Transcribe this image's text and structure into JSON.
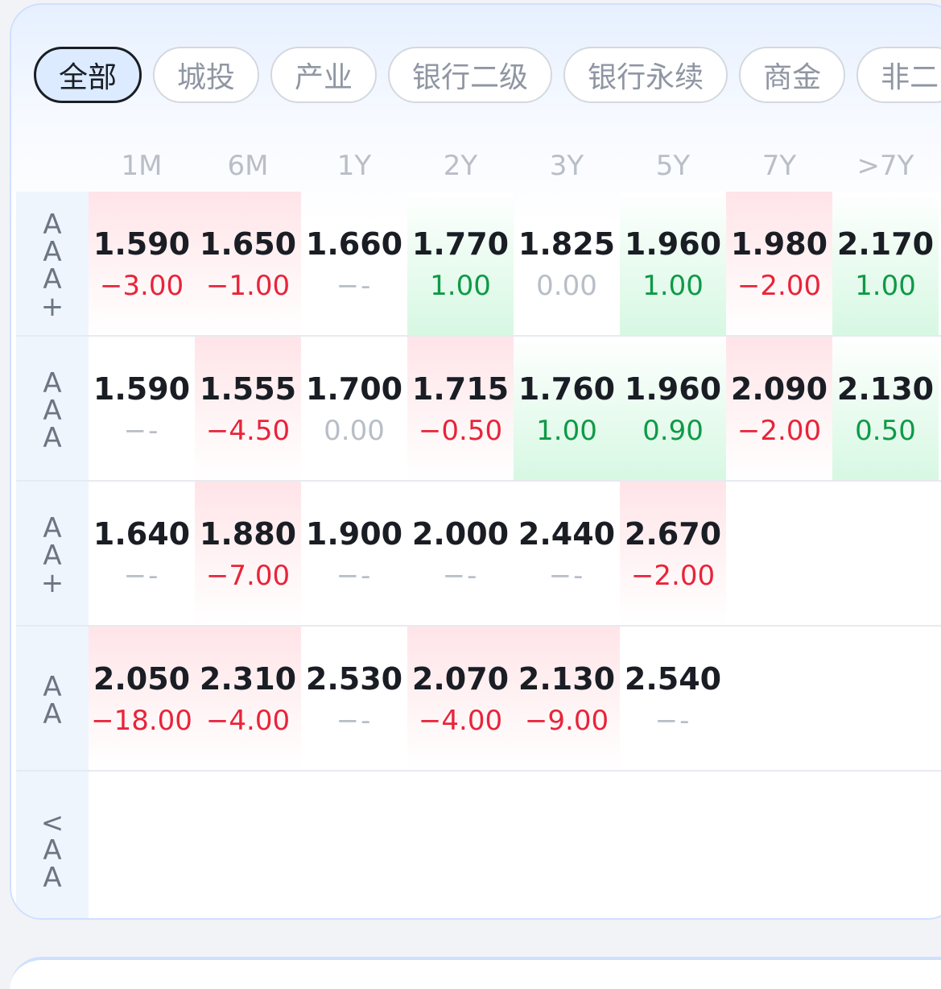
{
  "tabs": [
    {
      "label": "全部",
      "active": true
    },
    {
      "label": "城投",
      "active": false
    },
    {
      "label": "产业",
      "active": false
    },
    {
      "label": "银行二级",
      "active": false
    },
    {
      "label": "银行永续",
      "active": false
    },
    {
      "label": "商金",
      "active": false
    },
    {
      "label": "非二",
      "active": false
    }
  ],
  "tenors": [
    "1M",
    "6M",
    "1Y",
    "2Y",
    "3Y",
    "5Y",
    "7Y",
    ">7Y"
  ],
  "colors": {
    "up_red": "#e8243a",
    "down_green": "#0e9a47",
    "muted": "#b8bec7"
  },
  "rows": [
    {
      "rating": "AAA+",
      "cells": [
        {
          "yield": "1.590",
          "change": "-3.00",
          "dir": "up"
        },
        {
          "yield": "1.650",
          "change": "-1.00",
          "dir": "up"
        },
        {
          "yield": "1.660",
          "change": "--",
          "dir": "none"
        },
        {
          "yield": "1.770",
          "change": "1.00",
          "dir": "down"
        },
        {
          "yield": "1.825",
          "change": "0.00",
          "dir": "zero"
        },
        {
          "yield": "1.960",
          "change": "1.00",
          "dir": "down"
        },
        {
          "yield": "1.980",
          "change": "-2.00",
          "dir": "up"
        },
        {
          "yield": "2.170",
          "change": "1.00",
          "dir": "down"
        }
      ]
    },
    {
      "rating": "AAA",
      "cells": [
        {
          "yield": "1.590",
          "change": "--",
          "dir": "none"
        },
        {
          "yield": "1.555",
          "change": "-4.50",
          "dir": "up"
        },
        {
          "yield": "1.700",
          "change": "0.00",
          "dir": "zero"
        },
        {
          "yield": "1.715",
          "change": "-0.50",
          "dir": "up"
        },
        {
          "yield": "1.760",
          "change": "1.00",
          "dir": "down"
        },
        {
          "yield": "1.960",
          "change": "0.90",
          "dir": "down"
        },
        {
          "yield": "2.090",
          "change": "-2.00",
          "dir": "up"
        },
        {
          "yield": "2.130",
          "change": "0.50",
          "dir": "down"
        }
      ]
    },
    {
      "rating": "AA+",
      "cells": [
        {
          "yield": "1.640",
          "change": "--",
          "dir": "none"
        },
        {
          "yield": "1.880",
          "change": "-7.00",
          "dir": "up"
        },
        {
          "yield": "1.900",
          "change": "--",
          "dir": "none"
        },
        {
          "yield": "2.000",
          "change": "--",
          "dir": "none"
        },
        {
          "yield": "2.440",
          "change": "--",
          "dir": "none"
        },
        {
          "yield": "2.670",
          "change": "-2.00",
          "dir": "up"
        },
        {
          "yield": "",
          "change": "",
          "dir": "empty"
        },
        {
          "yield": "",
          "change": "",
          "dir": "empty"
        }
      ]
    },
    {
      "rating": "AA",
      "cells": [
        {
          "yield": "2.050",
          "change": "-18.00",
          "dir": "up"
        },
        {
          "yield": "2.310",
          "change": "-4.00",
          "dir": "up"
        },
        {
          "yield": "2.530",
          "change": "--",
          "dir": "none"
        },
        {
          "yield": "2.070",
          "change": "-4.00",
          "dir": "up"
        },
        {
          "yield": "2.130",
          "change": "-9.00",
          "dir": "up"
        },
        {
          "yield": "2.540",
          "change": "--",
          "dir": "none"
        },
        {
          "yield": "",
          "change": "",
          "dir": "empty"
        },
        {
          "yield": "",
          "change": "",
          "dir": "empty"
        }
      ]
    },
    {
      "rating": "<AA",
      "cells": [
        {
          "yield": "",
          "change": "",
          "dir": "empty"
        },
        {
          "yield": "",
          "change": "",
          "dir": "empty"
        },
        {
          "yield": "",
          "change": "",
          "dir": "empty"
        },
        {
          "yield": "",
          "change": "",
          "dir": "empty"
        },
        {
          "yield": "",
          "change": "",
          "dir": "empty"
        },
        {
          "yield": "",
          "change": "",
          "dir": "empty"
        },
        {
          "yield": "",
          "change": "",
          "dir": "empty"
        },
        {
          "yield": "",
          "change": "",
          "dir": "empty"
        }
      ]
    }
  ]
}
